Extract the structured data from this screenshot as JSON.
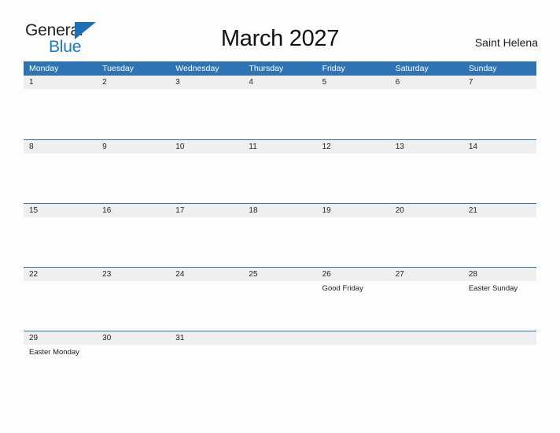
{
  "header": {
    "logo": {
      "word_top": "General",
      "word_bottom": "Blue",
      "flag_icon": "blue-triangle-flag-icon"
    },
    "title": "March 2027",
    "region": "Saint Helena"
  },
  "colors": {
    "header_blue": "#2e74b5",
    "logo_blue": "#1b7ac4",
    "date_band_gray": "#efefef",
    "page_background": "#fdfdfd",
    "text_dark": "#1c1c1c"
  },
  "calendar": {
    "weekdays": [
      "Monday",
      "Tuesday",
      "Wednesday",
      "Thursday",
      "Friday",
      "Saturday",
      "Sunday"
    ],
    "weeks": [
      {
        "days": [
          {
            "date": "1",
            "event": ""
          },
          {
            "date": "2",
            "event": ""
          },
          {
            "date": "3",
            "event": ""
          },
          {
            "date": "4",
            "event": ""
          },
          {
            "date": "5",
            "event": ""
          },
          {
            "date": "6",
            "event": ""
          },
          {
            "date": "7",
            "event": ""
          }
        ]
      },
      {
        "days": [
          {
            "date": "8",
            "event": ""
          },
          {
            "date": "9",
            "event": ""
          },
          {
            "date": "10",
            "event": ""
          },
          {
            "date": "11",
            "event": ""
          },
          {
            "date": "12",
            "event": ""
          },
          {
            "date": "13",
            "event": ""
          },
          {
            "date": "14",
            "event": ""
          }
        ]
      },
      {
        "days": [
          {
            "date": "15",
            "event": ""
          },
          {
            "date": "16",
            "event": ""
          },
          {
            "date": "17",
            "event": ""
          },
          {
            "date": "18",
            "event": ""
          },
          {
            "date": "19",
            "event": ""
          },
          {
            "date": "20",
            "event": ""
          },
          {
            "date": "21",
            "event": ""
          }
        ]
      },
      {
        "days": [
          {
            "date": "22",
            "event": ""
          },
          {
            "date": "23",
            "event": ""
          },
          {
            "date": "24",
            "event": ""
          },
          {
            "date": "25",
            "event": ""
          },
          {
            "date": "26",
            "event": "Good Friday"
          },
          {
            "date": "27",
            "event": ""
          },
          {
            "date": "28",
            "event": "Easter Sunday"
          }
        ]
      },
      {
        "days": [
          {
            "date": "29",
            "event": "Easter Monday"
          },
          {
            "date": "30",
            "event": ""
          },
          {
            "date": "31",
            "event": ""
          },
          {
            "date": "",
            "event": ""
          },
          {
            "date": "",
            "event": ""
          },
          {
            "date": "",
            "event": ""
          },
          {
            "date": "",
            "event": ""
          }
        ]
      }
    ]
  }
}
